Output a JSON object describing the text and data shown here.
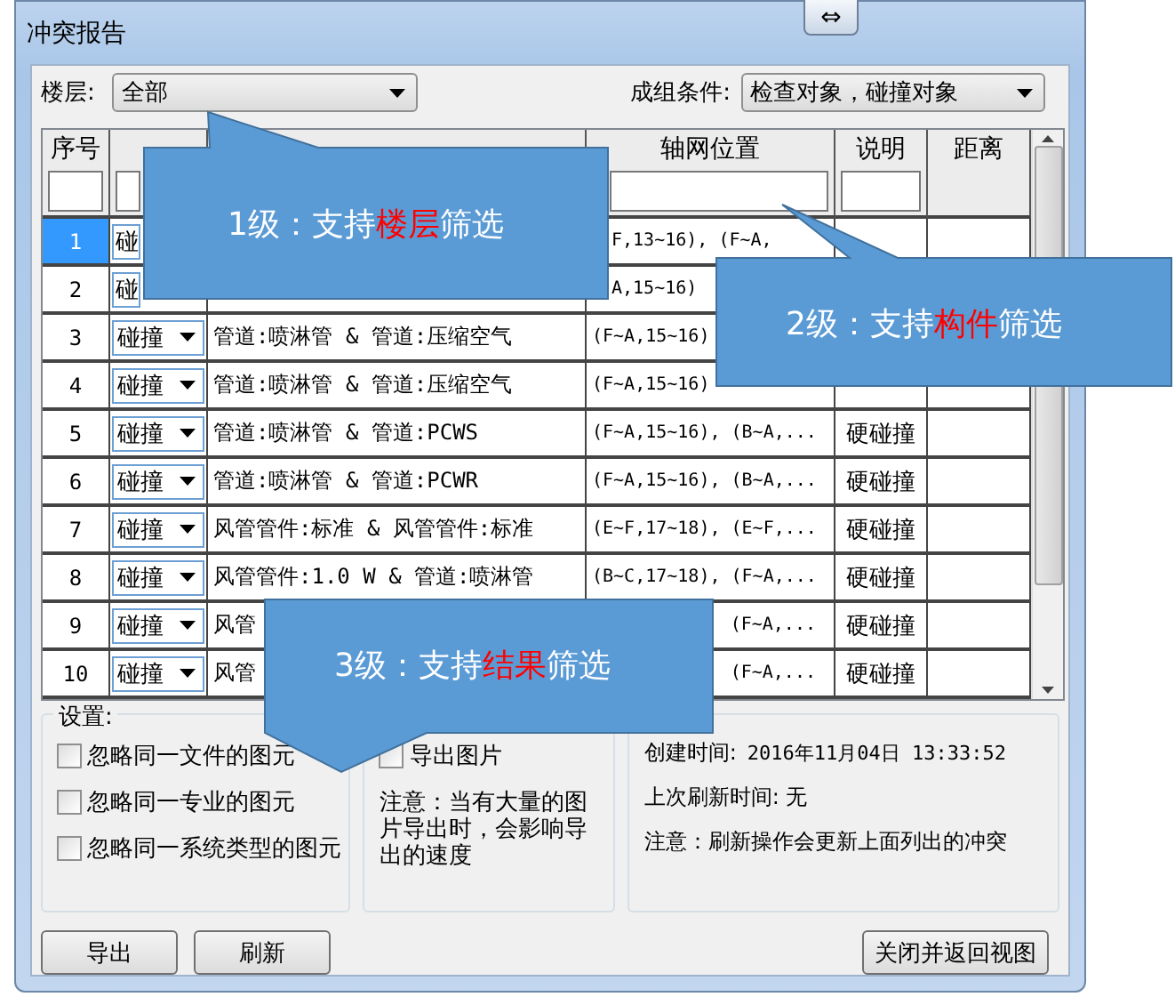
{
  "window": {
    "title": "冲突报告",
    "restore_button": "⇔"
  },
  "floor": {
    "label": "楼层:",
    "value": "全部"
  },
  "grouping": {
    "label": "成组条件:",
    "value": "检查对象，碰撞对象"
  },
  "table": {
    "columns": [
      {
        "label": "序号",
        "filter": true
      },
      {
        "filter": true
      },
      {},
      {
        "label": "轴网位置",
        "filter": true
      },
      {
        "label": "说明",
        "filter": true
      },
      {
        "label": "距离",
        "filter": false
      }
    ],
    "rows": [
      {
        "no": "1",
        "selected": true,
        "status": "碰",
        "dropdown": false,
        "grid": "F,13~16), (F~A,",
        "start_hidden": true,
        "middle_hidden": false
      },
      {
        "no": "2",
        "selected": false,
        "status": "碰",
        "dropdown": false,
        "grid": "A,15~16)",
        "start_hidden": true,
        "middle_hidden": false
      },
      {
        "no": "3",
        "selected": false,
        "status": "碰撞",
        "dropdown": true,
        "info": "管道:喷淋管 & 管道:压缩空气",
        "grid": "(F~A,15~16)",
        "start_hidden": false,
        "middle_hidden": false
      },
      {
        "no": "4",
        "selected": false,
        "status": "碰撞",
        "dropdown": true,
        "info": "管道:喷淋管 & 管道:压缩空气",
        "grid": "(F~A,15~16)",
        "start_hidden": false,
        "middle_hidden": false
      },
      {
        "no": "5",
        "selected": false,
        "status": "碰撞",
        "dropdown": true,
        "info": "管道:喷淋管 & 管道:PCWS",
        "grid": "(F~A,15~16), (B~A,...",
        "start_hidden": false,
        "middle_hidden": false,
        "note": "硬碰撞"
      },
      {
        "no": "6",
        "selected": false,
        "status": "碰撞",
        "dropdown": true,
        "info": "管道:喷淋管 & 管道:PCWR",
        "grid": "(F~A,15~16), (B~A,...",
        "start_hidden": false,
        "middle_hidden": false,
        "note": "硬碰撞"
      },
      {
        "no": "7",
        "selected": false,
        "status": "碰撞",
        "dropdown": true,
        "info": "风管管件:标准 & 风管管件:标准",
        "grid": "(E~F,17~18), (E~F,...",
        "start_hidden": false,
        "middle_hidden": false,
        "note": "硬碰撞"
      },
      {
        "no": "8",
        "selected": false,
        "status": "碰撞",
        "dropdown": true,
        "info": "风管管件:1.0 W & 管道:喷淋管",
        "grid": "(B~C,17~18), (F~A,...",
        "start_hidden": false,
        "middle_hidden": false,
        "note": "硬碰撞"
      },
      {
        "no": "9",
        "selected": false,
        "status": "碰撞",
        "dropdown": true,
        "info": "风管",
        "grid": "(F~A,...",
        "start_hidden": false,
        "middle_hidden": true,
        "note": "硬碰撞"
      },
      {
        "no": "10",
        "selected": false,
        "status": "碰撞",
        "dropdown": true,
        "info": "风管",
        "grid": "(F~A,...",
        "start_hidden": false,
        "middle_hidden": true,
        "note": "硬碰撞"
      }
    ]
  },
  "settings": {
    "title": "设置:",
    "options": [
      {
        "label": "忽略同一文件的图元",
        "checked": false
      },
      {
        "label": "忽略同一专业的图元",
        "checked": false
      },
      {
        "label": "忽略同一系统类型的图元",
        "checked": false
      }
    ]
  },
  "export": {
    "options": [
      {
        "label": "导出图片",
        "checked": false
      }
    ],
    "note": "注意：当有大量的图片导出时，会影响导出的速度"
  },
  "info": {
    "created_label": "创建时间:",
    "created": "2016年11月04日 13:33:52",
    "refreshed": "上次刷新时间: 无",
    "note": "注意：刷新操作会更新上面列出的冲突"
  },
  "buttons": {
    "left": [
      "导出",
      "刷新"
    ],
    "right": "关闭并返回视图"
  },
  "callouts": [
    {
      "before": "1级：支持",
      "highlight": "楼层",
      "after": "筛选"
    },
    {
      "before": "2级：支持",
      "highlight": "构件",
      "after": "筛选"
    },
    {
      "before": "3级：支持",
      "highlight": "结果",
      "after": "筛选"
    }
  ]
}
